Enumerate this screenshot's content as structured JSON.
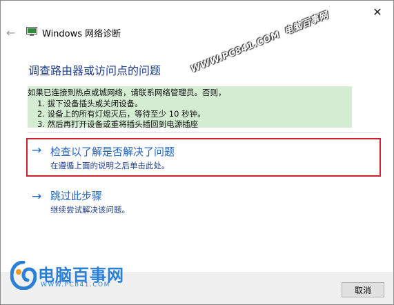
{
  "window": {
    "title": "Windows 网络诊断",
    "close_glyph": "✕",
    "back_glyph": "←"
  },
  "heading": "调查路由器或访问点的问题",
  "info": {
    "intro": "如果已连接到热点或城网络，请联系网络管理员。否则，",
    "steps": [
      "1.  拔下设备插头或关闭设备。",
      "2.  设备上的所有灯熄灭后，等待至少 10 秒钟。",
      "3.  然后再打开设备或重将插头插回到电源插座"
    ]
  },
  "options": [
    {
      "main": "检查以了解是否解决了问题",
      "sub": "在遵循上面的说明之后单击此处。",
      "arrow": "→"
    },
    {
      "main": "跳过此步骤",
      "sub": "继续尝试解决该问题。",
      "arrow": "→"
    }
  ],
  "watermark": {
    "url": "WWW.PC841.COM",
    "name": "电脑百事网"
  },
  "logo": {
    "name": "电脑百事网",
    "url": "WWW.PC841.COM"
  },
  "footer": {
    "cancel_label": "取消"
  },
  "colors": {
    "link_blue": "#1f66c4",
    "heading_blue": "#1e3d8a",
    "info_green": "#d3ecd2",
    "highlight_red": "#d0202a"
  }
}
